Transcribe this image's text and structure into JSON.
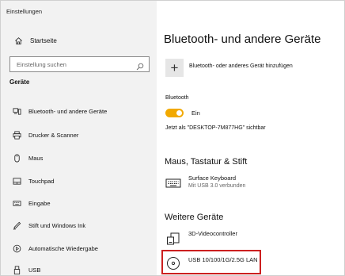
{
  "window": {
    "title": "Einstellungen"
  },
  "sidebar": {
    "home_label": "Startseite",
    "search_placeholder": "Einstellung suchen",
    "section_label": "Geräte",
    "items": [
      {
        "label": "Bluetooth- und andere Geräte",
        "icon": "bluetooth-devices-icon"
      },
      {
        "label": "Drucker & Scanner",
        "icon": "printer-icon"
      },
      {
        "label": "Maus",
        "icon": "mouse-icon"
      },
      {
        "label": "Touchpad",
        "icon": "touchpad-icon"
      },
      {
        "label": "Eingabe",
        "icon": "keyboard-icon"
      },
      {
        "label": "Stift und Windows Ink",
        "icon": "pen-icon"
      },
      {
        "label": "Automatische Wiedergabe",
        "icon": "autoplay-icon"
      },
      {
        "label": "USB",
        "icon": "usb-icon"
      }
    ]
  },
  "main": {
    "title": "Bluetooth- und andere Geräte",
    "add_device_label": "Bluetooth- oder anderes Gerät hinzufügen",
    "bluetooth": {
      "label": "Bluetooth",
      "toggle_state": "Ein",
      "toggle_on": true,
      "accent_color": "#f2a900",
      "visible_as": "Jetzt als \"DESKTOP-7M877HG\" sichtbar"
    },
    "input_section": {
      "title": "Maus, Tastatur & Stift",
      "devices": [
        {
          "name": "Surface Keyboard",
          "status": "Mit USB 3.0 verbunden",
          "icon": "keyboard-device-icon"
        }
      ]
    },
    "other_section": {
      "title": "Weitere Geräte",
      "devices": [
        {
          "name": "3D-Videocontroller",
          "icon": "generic-device-icon"
        },
        {
          "name": "USB 10/100/1G/2.5G LAN",
          "icon": "disc-device-icon"
        }
      ]
    },
    "highlight_color": "#cc1f1f"
  }
}
